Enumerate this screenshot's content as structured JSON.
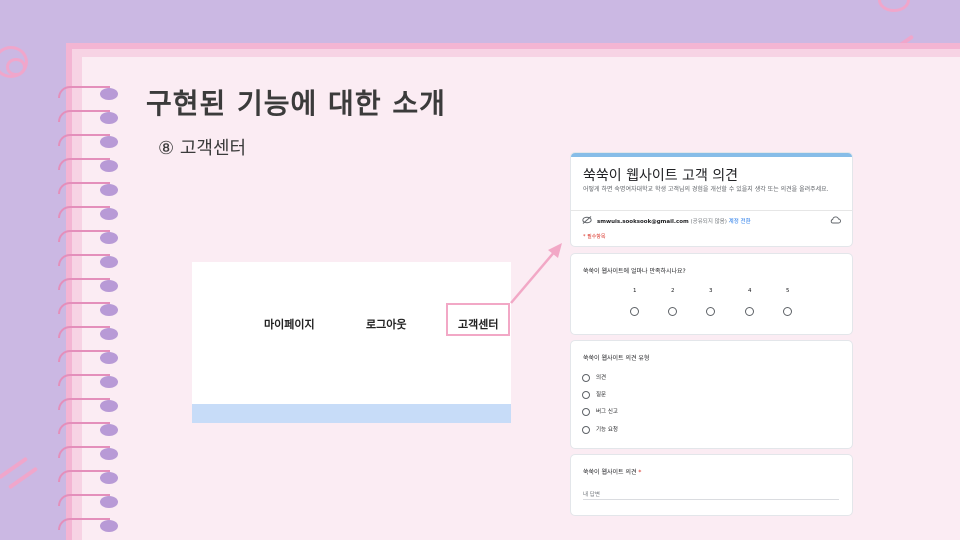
{
  "slide": {
    "title": "구현된 기능에 대한 소개",
    "subtitle": "⑧ 고객센터"
  },
  "nav": {
    "items": [
      "마이페이지",
      "로그아웃",
      "고객센터"
    ]
  },
  "form": {
    "title": "쑥쑥이 웹사이트 고객 의견",
    "description": "어떻게 하면 숙명여자대학교 학생 고객님의 경험을 개선할 수 있을지 생각 또는 의견을 올려주세요.",
    "account_email": "smwuis.sooksook@gmail.com",
    "account_note": "(공유되지 않음)",
    "account_switch": "계정 전환",
    "required_note": "* 필수항목",
    "q1": {
      "text": "쑥쑥이 웹사이트에 얼마나 만족하시나요?",
      "scale": [
        "1",
        "2",
        "3",
        "4",
        "5"
      ]
    },
    "q2": {
      "text": "쑥쑥이 웹사이트 의견 유형",
      "options": [
        "의견",
        "질문",
        "버그 신고",
        "기능 요청"
      ]
    },
    "q3": {
      "text": "쑥쑥이 웹사이트 의견",
      "required_mark": "*",
      "placeholder": "내 답변"
    }
  },
  "colors": {
    "background": "#cbb8e3",
    "notebook_border": "#f3b5d3",
    "paper": "#fbecf3",
    "highlight": "#f2a8c6",
    "form_accent": "#87bde8",
    "nav_strip": "#c7dcf8"
  }
}
